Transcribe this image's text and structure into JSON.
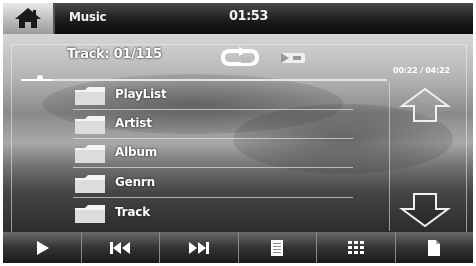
{
  "header": {
    "app_title": "Music",
    "clock": "01:53"
  },
  "player": {
    "track_label": "Track:",
    "track_position": "01/115",
    "elapsed": "00:22",
    "total": "04:22",
    "time_separator": "/",
    "progress_fraction": 0.086,
    "repeat_icon": "repeat-icon",
    "shuffle_icon": "shuffle-icon"
  },
  "browser": {
    "items": [
      {
        "label": "PlayList",
        "icon": "folder-icon"
      },
      {
        "label": "Artist",
        "icon": "folder-icon"
      },
      {
        "label": "Album",
        "icon": "folder-icon"
      },
      {
        "label": "Genrn",
        "icon": "folder-icon"
      },
      {
        "label": "Track",
        "icon": "folder-icon"
      }
    ],
    "scroll_up_icon": "arrow-up-icon",
    "scroll_down_icon": "arrow-down-icon"
  },
  "toolbar": {
    "buttons": [
      {
        "name": "play",
        "icon": "play-icon"
      },
      {
        "name": "previous",
        "icon": "previous-icon"
      },
      {
        "name": "next",
        "icon": "next-icon"
      },
      {
        "name": "list",
        "icon": "list-icon"
      },
      {
        "name": "grid",
        "icon": "grid-icon"
      },
      {
        "name": "document",
        "icon": "document-icon"
      }
    ]
  },
  "colors": {
    "text": "#ffffff",
    "bar_dark": "#1a1a1a",
    "bar_light": "#6a6a6a"
  }
}
